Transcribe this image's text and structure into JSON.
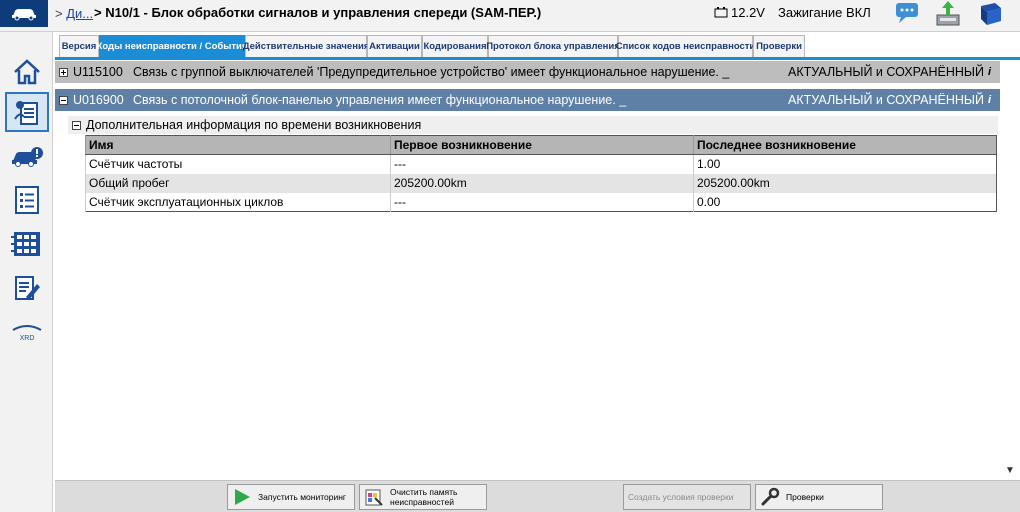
{
  "header": {
    "crumb_prefix": ">",
    "crumb_link": "Ди...",
    "title": "> N10/1 - Блок обработки сигналов и управления спереди (SAM-ПЕР.)",
    "voltage": "12.2V",
    "ignition": "Зажигание ВКЛ"
  },
  "tabs": [
    {
      "label": "Версия"
    },
    {
      "label": "Коды неисправности / События"
    },
    {
      "label": "Действительные значения"
    },
    {
      "label": "Активации"
    },
    {
      "label": "Кодирования"
    },
    {
      "label": "Протокол блока управления"
    },
    {
      "label": "Список кодов неисправности"
    },
    {
      "label": "Проверки"
    }
  ],
  "faults": [
    {
      "code": "U115100",
      "description": "Связь с группой выключателей 'Предупредительное устройство' имеет функциональное нарушение. _",
      "status": "АКТУАЛЬНЫЙ и СОХРАНЁННЫЙ",
      "info": "i"
    },
    {
      "code": "U016900",
      "description": "Связь с потолочной блок-панелью управления имеет функциональное нарушение. _",
      "status": "АКТУАЛЬНЫЙ и СОХРАНЁННЫЙ",
      "info": "i"
    }
  ],
  "subsection": {
    "title": "Дополнительная информация по времени возникновения",
    "columns": [
      "Имя",
      "Первое возникновение",
      "Последнее возникновение"
    ],
    "rows": [
      [
        "Счётчик частоты",
        "---",
        "1.00"
      ],
      [
        "Общий пробег",
        "205200.00km",
        "205200.00km"
      ],
      [
        "Счётчик эксплуатационных циклов",
        "---",
        "0.00"
      ]
    ]
  },
  "bottom": {
    "start_monitoring": "Запустить мониторинг",
    "clear_memory_1": "Очистить память",
    "clear_memory_2": "неисправностей",
    "create_conditions": "Создать условия проверки",
    "checks": "Проверки"
  },
  "sidebar": {
    "xrd_label": "XRD"
  },
  "colors": {
    "accent": "#1b8dd6",
    "selected_row": "#5f80a6",
    "logo_bg": "#0e3c7a"
  }
}
